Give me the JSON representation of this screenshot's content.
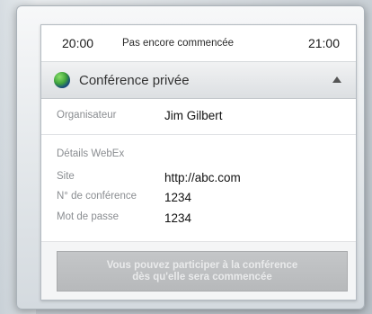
{
  "meeting": {
    "start_time": "20:00",
    "status": "Pas encore commencée",
    "end_time": "21:00",
    "title": "Conférence privée",
    "globe_icon": "globe-icon",
    "collapse_icon": "chevron-up-icon"
  },
  "organizer": {
    "label": "Organisateur",
    "value": "Jim Gilbert"
  },
  "webex": {
    "section_label": "Détails WebEx",
    "site_label": "Site",
    "site_value": "http://abc.com",
    "conf_label": "N° de conférence",
    "conf_value": "1234",
    "password_label": "Mot de passe",
    "password_value": "1234"
  },
  "join": {
    "line1": "Vous pouvez participer à la conférence",
    "line2": "dès qu'elle sera commencée"
  }
}
